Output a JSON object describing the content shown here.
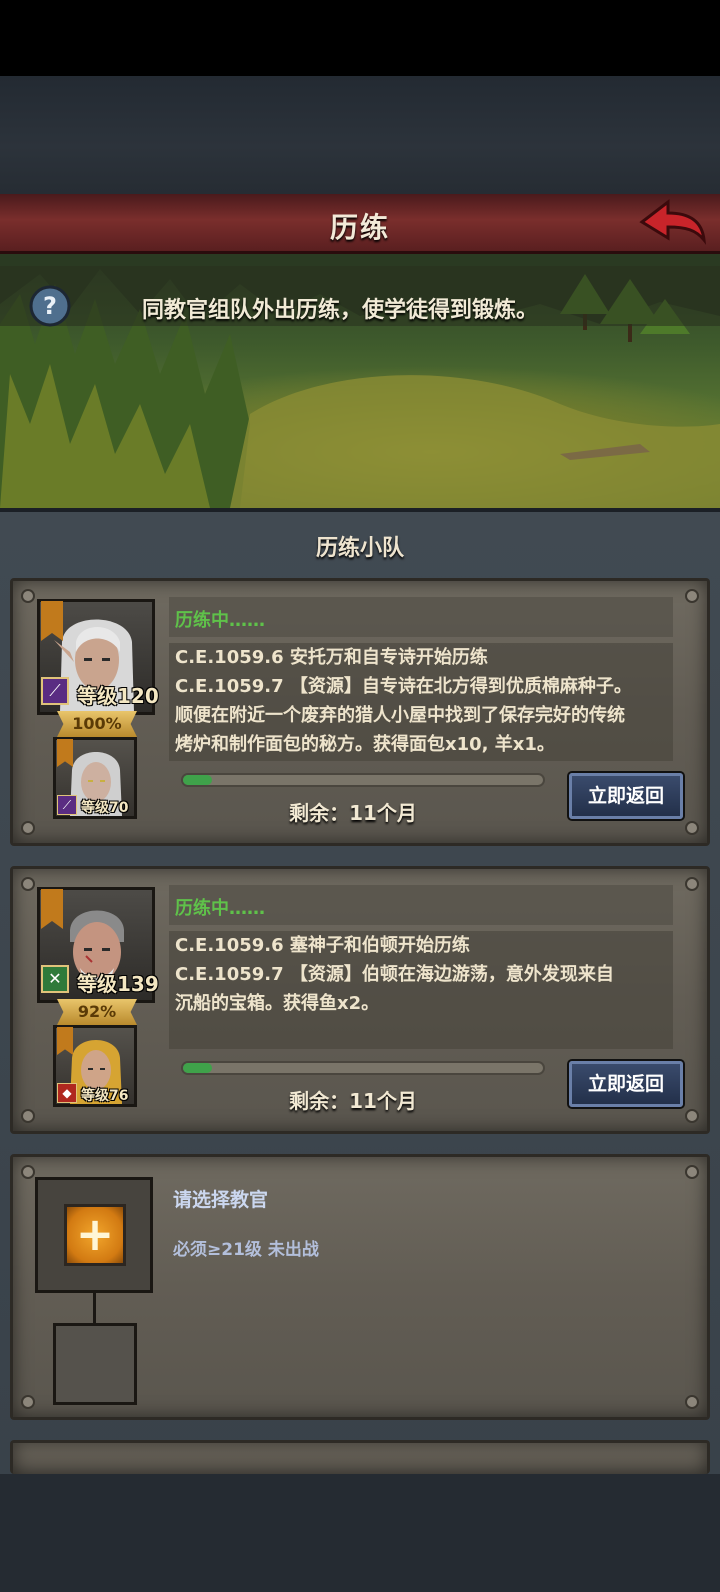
{
  "header": {
    "title": "历练",
    "back_icon": "back-arrow-icon"
  },
  "banner": {
    "description": "同教官组队外出历练，使学徒得到锻炼。",
    "help_icon": "question-icon"
  },
  "section": {
    "title": "历练小队"
  },
  "teams": [
    {
      "instructor": {
        "level": "等级120",
        "progress": "100%",
        "progress_value": 1.0
      },
      "apprentice": {
        "level": "等级70"
      },
      "status": "历练中……",
      "log": [
        "C.E.1059.6  安托万和自专诗开始历练",
        "C.E.1059.7  【资源】自专诗在北方得到优质棉麻种子。",
        "顺便在附近一个废弃的猎人小屋中找到了保存完好的传统",
        "烤炉和制作面包的秘方。获得面包x10, 羊x1。"
      ],
      "remaining": "剩余：11个月",
      "trip_progress": 0.08,
      "return_button": "立即返回"
    },
    {
      "instructor": {
        "level": "等级139",
        "progress": "92%",
        "progress_value": 0.92
      },
      "apprentice": {
        "level": "等级76"
      },
      "status": "历练中……",
      "log": [
        "C.E.1059.6  塞神子和伯顿开始历练",
        "C.E.1059.7  【资源】伯顿在海边游荡，意外发现来自",
        "沉船的宝箱。获得鱼x2。"
      ],
      "remaining": "剩余：11个月",
      "trip_progress": 0.08,
      "return_button": "立即返回"
    }
  ],
  "empty_slot": {
    "label": "请选择教官",
    "requirement": "必须≥21级 未出战",
    "add_icon": "plus-icon"
  },
  "colors": {
    "title_bar": "#7a2e2c",
    "status_green": "#5fc24a",
    "button_blue": "#23304a",
    "progress_green": "#3fa24a"
  }
}
